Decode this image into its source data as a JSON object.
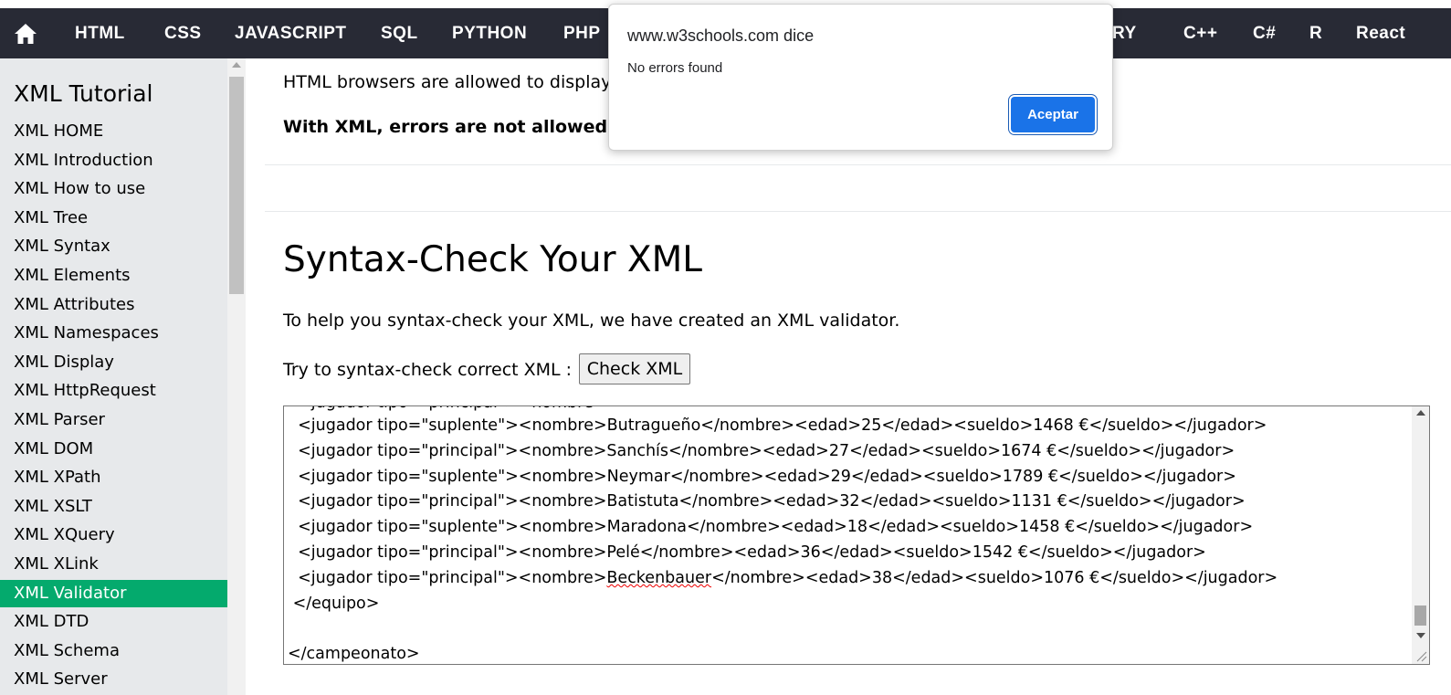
{
  "topnav": {
    "home_icon": "home-icon",
    "items": [
      "HTML",
      "CSS",
      "JAVASCRIPT",
      "SQL",
      "PYTHON",
      "PHP",
      "RY",
      "C++",
      "C#",
      "R",
      "React"
    ]
  },
  "sidebar": {
    "title": "XML Tutorial",
    "items": [
      "XML HOME",
      "XML Introduction",
      "XML How to use",
      "XML Tree",
      "XML Syntax",
      "XML Elements",
      "XML Attributes",
      "XML Namespaces",
      "XML Display",
      "XML HttpRequest",
      "XML Parser",
      "XML DOM",
      "XML XPath",
      "XML XSLT",
      "XML XQuery",
      "XML XLink",
      "XML Validator",
      "XML DTD",
      "XML Schema",
      "XML Server"
    ],
    "active_index": 16
  },
  "main": {
    "para1": "HTML browsers are allowed to display",
    "para2": "With XML, errors are not allowed.",
    "heading": "Syntax-Check Your XML",
    "para3": "To help you syntax-check your XML, we have created an XML validator.",
    "para4": "Try to syntax-check correct XML :",
    "check_button": "Check XML"
  },
  "editor": {
    "lines": [
      {
        "pre": "  <jugador tipo=\"suplente\"><nombre>",
        "word": "Butragueño",
        "spell": false,
        "post": "</nombre><edad>25</edad><sueldo>1468 €</sueldo></jugador>"
      },
      {
        "pre": "  <jugador tipo=\"principal\"><nombre>",
        "word": "Sanchís",
        "spell": false,
        "post": "</nombre><edad>27</edad><sueldo>1674 €</sueldo></jugador>"
      },
      {
        "pre": "  <jugador tipo=\"suplente\"><nombre>",
        "word": "Neymar",
        "spell": false,
        "post": "</nombre><edad>29</edad><sueldo>1789 €</sueldo></jugador>"
      },
      {
        "pre": "  <jugador tipo=\"principal\"><nombre>",
        "word": "Batistuta",
        "spell": false,
        "post": "</nombre><edad>32</edad><sueldo>1131 €</sueldo></jugador>"
      },
      {
        "pre": "  <jugador tipo=\"suplente\"><nombre>",
        "word": "Maradona",
        "spell": false,
        "post": "</nombre><edad>18</edad><sueldo>1458 €</sueldo></jugador>"
      },
      {
        "pre": "  <jugador tipo=\"principal\"><nombre>",
        "word": "Pelé",
        "spell": false,
        "post": "</nombre><edad>36</edad><sueldo>1542 €</sueldo></jugador>"
      },
      {
        "pre": "  <jugador tipo=\"principal\"><nombre>",
        "word": "Beckenbauer",
        "spell": true,
        "post": "</nombre><edad>38</edad><sueldo>1076 €</sueldo></jugador>"
      },
      {
        "pre": " </equipo>",
        "word": "",
        "spell": false,
        "post": ""
      },
      {
        "pre": "",
        "word": "",
        "spell": false,
        "post": ""
      },
      {
        "pre": "</campeonato>",
        "word": "",
        "spell": false,
        "post": ""
      }
    ]
  },
  "dialog": {
    "title": "www.w3schools.com dice",
    "message": "No errors found",
    "ok_button": "Aceptar"
  },
  "colors": {
    "topnav_bg": "#282A35",
    "sidebar_bg": "#E7E9EB",
    "active_green": "#04AA6D",
    "dialog_button_blue": "#1A73E8"
  }
}
